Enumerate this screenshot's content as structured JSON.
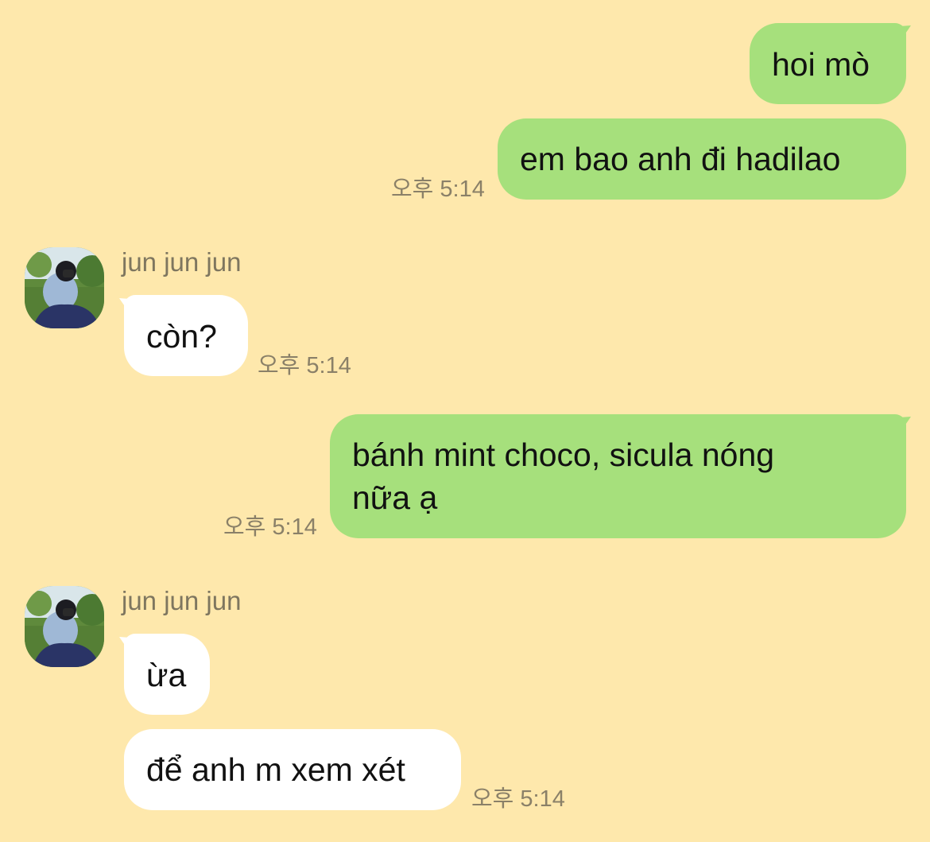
{
  "colors": {
    "background": "#fee8ac",
    "sent_bubble": "#a6e07c",
    "received_bubble": "#ffffff",
    "timestamp": "#8a8068",
    "sender_name": "#7e765f"
  },
  "messages": [
    {
      "id": "m1",
      "direction": "sent",
      "text": "hoi mò",
      "time": ""
    },
    {
      "id": "m2",
      "direction": "sent",
      "text": "em bao anh đi hadilao",
      "time": "오후 5:14"
    },
    {
      "id": "m3",
      "direction": "received",
      "sender": "jun jun jun",
      "text": "còn?",
      "time": "오후 5:14"
    },
    {
      "id": "m4",
      "direction": "sent",
      "text_line1": "bánh mint choco, sicula nóng",
      "text_line2": "nữa ạ",
      "time": "오후 5:14"
    },
    {
      "id": "m5",
      "direction": "received",
      "sender": "jun jun jun",
      "text": "ừa",
      "time": ""
    },
    {
      "id": "m6",
      "direction": "received",
      "text": "để anh m xem xét",
      "time": "오후 5:14"
    }
  ],
  "avatar_icon": "profile-photo"
}
